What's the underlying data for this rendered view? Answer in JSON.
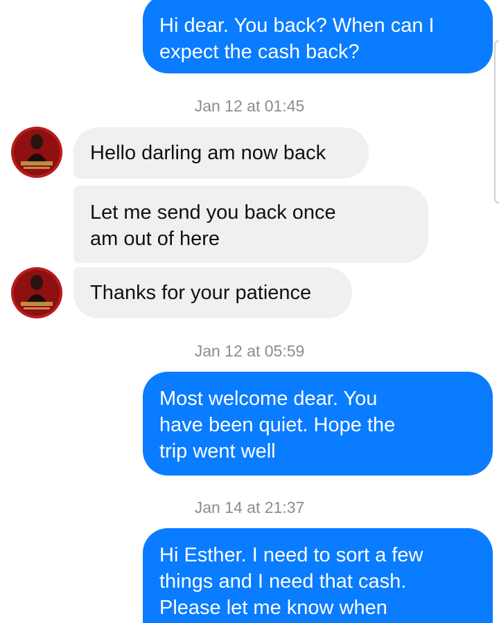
{
  "conversation": {
    "contact_name": "Esther",
    "messages": [
      {
        "direction": "outgoing",
        "text": "Hi dear.  You back? When can I\nexpect the cash back?"
      },
      {
        "direction": "timestamp",
        "text": "Jan 12 at 01:45"
      },
      {
        "direction": "incoming",
        "text": "Hello darling am now back"
      },
      {
        "direction": "incoming",
        "text": "Let me send you back once\nam out of here"
      },
      {
        "direction": "incoming",
        "text": "Thanks for your patience"
      },
      {
        "direction": "timestamp",
        "text": "Jan 12 at 05:59"
      },
      {
        "direction": "outgoing",
        "text": "Most welcome dear. You\nhave been quiet. Hope the\ntrip went well"
      },
      {
        "direction": "timestamp",
        "text": "Jan 14 at 21:37"
      },
      {
        "direction": "outgoing",
        "text": "Hi Esther.  I need to sort a few\nthings and I need that cash.\nPlease let me know when"
      }
    ]
  },
  "colors": {
    "outgoing_bubble": "#0a7cff",
    "incoming_bubble": "#f0f0f0",
    "timestamp_text": "#8a8d91",
    "avatar_background": "#b71c1c"
  },
  "icons": {
    "avatar": "contact-avatar-icon"
  }
}
